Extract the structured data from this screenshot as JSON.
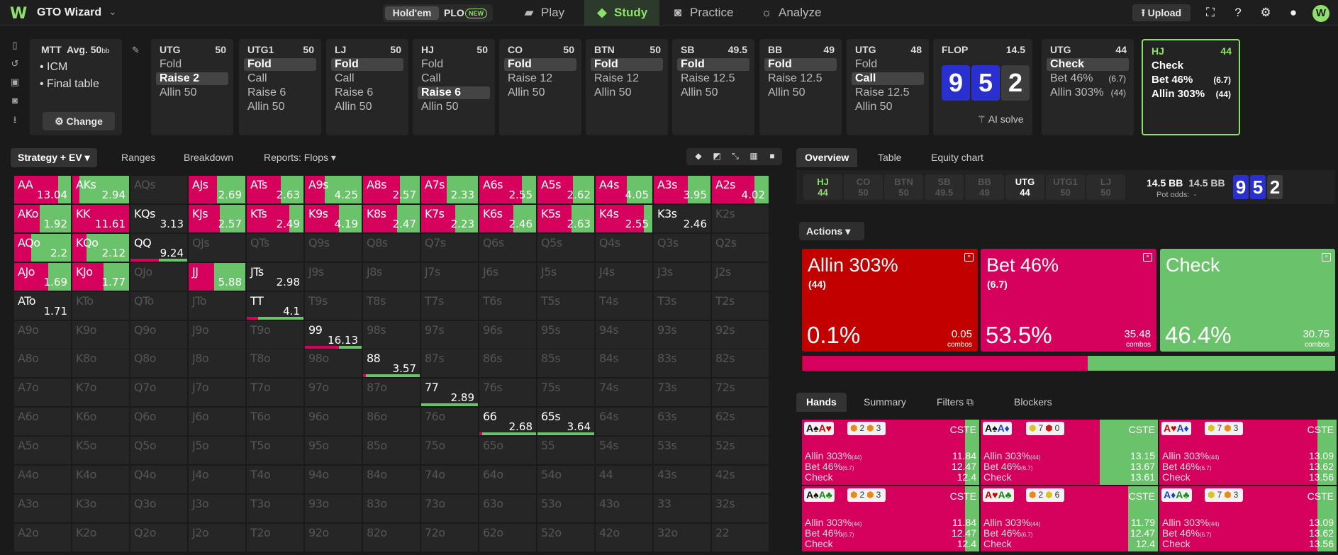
{
  "app": {
    "logo": "W",
    "title": "GTO Wizard"
  },
  "game_toggle": {
    "holdem": "Hold'em",
    "plo": "PLO",
    "new_badge": "NEW"
  },
  "nav": [
    {
      "label": "Play",
      "icon": "play-icon"
    },
    {
      "label": "Study",
      "icon": "study-icon"
    },
    {
      "label": "Practice",
      "icon": "controller-icon"
    },
    {
      "label": "Analyze",
      "icon": "bulb-icon"
    }
  ],
  "upload_label": "Upload",
  "mtt": {
    "title": "MTT",
    "avg": "Avg. 50",
    "bb": "bb",
    "bullets": [
      "ICM",
      "Final table"
    ],
    "change": "Change"
  },
  "positions": [
    {
      "name": "UTG",
      "stack": "50",
      "actions": [
        "Fold",
        "Raise 2",
        "Allin 50"
      ],
      "selected": 1
    },
    {
      "name": "UTG1",
      "stack": "50",
      "actions": [
        "Fold",
        "Call",
        "Raise 6",
        "Allin 50"
      ],
      "selected": 0
    },
    {
      "name": "LJ",
      "stack": "50",
      "actions": [
        "Fold",
        "Call",
        "Raise 6",
        "Allin 50"
      ],
      "selected": 0
    },
    {
      "name": "HJ",
      "stack": "50",
      "actions": [
        "Fold",
        "Call",
        "Raise 6",
        "Allin 50"
      ],
      "selected": 2
    },
    {
      "name": "CO",
      "stack": "50",
      "actions": [
        "Fold",
        "Raise 12",
        "Allin 50"
      ],
      "selected": 0
    },
    {
      "name": "BTN",
      "stack": "50",
      "actions": [
        "Fold",
        "Raise 12",
        "Allin 50"
      ],
      "selected": 0
    },
    {
      "name": "SB",
      "stack": "49.5",
      "actions": [
        "Fold",
        "Raise 12.5",
        "Allin 50"
      ],
      "selected": 0
    },
    {
      "name": "BB",
      "stack": "49",
      "actions": [
        "Fold",
        "Raise 12.5",
        "Allin 50"
      ],
      "selected": 0
    },
    {
      "name": "UTG",
      "stack": "48",
      "actions": [
        "Fold",
        "Call",
        "Raise 12.5",
        "Allin 50"
      ],
      "selected": 1
    }
  ],
  "flop": {
    "name": "FLOP",
    "pot": "14.5",
    "cards": [
      "9",
      "5",
      "2"
    ],
    "ai_solve": "AI solve"
  },
  "utg_flop": {
    "name": "UTG",
    "stack": "44",
    "actions": [
      {
        "label": "Check",
        "r": ""
      },
      {
        "label": "Bet 46%",
        "r": "(6.7)"
      },
      {
        "label": "Allin 303%",
        "r": "(44)"
      }
    ]
  },
  "hj_flop": {
    "name": "HJ",
    "stack": "44",
    "actions": [
      {
        "label": "Check",
        "r": ""
      },
      {
        "label": "Bet 46%",
        "r": "(6.7)"
      },
      {
        "label": "Allin 303%",
        "r": "(44)"
      }
    ]
  },
  "left_tabs": {
    "strategy": "Strategy + EV",
    "ranges": "Ranges",
    "breakdown": "Breakdown",
    "reports": "Reports: Flops"
  },
  "right_tabs": [
    "Overview",
    "Table",
    "Equity chart"
  ],
  "info_chips": [
    {
      "n": "HJ",
      "s": "44"
    },
    {
      "n": "CO",
      "s": "50"
    },
    {
      "n": "BTN",
      "s": "50"
    },
    {
      "n": "SB",
      "s": "49.5"
    },
    {
      "n": "BB",
      "s": "49"
    },
    {
      "n": "UTG",
      "s": "44"
    },
    {
      "n": "UTG1",
      "s": "50"
    },
    {
      "n": "LJ",
      "s": "50"
    }
  ],
  "pot": {
    "a": "14.5 BB",
    "b": "14.5 BB",
    "odds_label": "Pot odds:",
    "odds": "-"
  },
  "actions_label": "Actions",
  "action_boxes": [
    {
      "name": "Allin 303%",
      "size": "(44)",
      "pct": "0.1%",
      "combos": "0.05",
      "combos_label": "combos",
      "color": "#c20000"
    },
    {
      "name": "Bet 46%",
      "size": "(6.7)",
      "pct": "53.5%",
      "combos": "35.48",
      "combos_label": "combos",
      "color": "#d6005d"
    },
    {
      "name": "Check",
      "size": "",
      "pct": "46.4%",
      "combos": "30.75",
      "combos_label": "combos",
      "color": "#6ac36a"
    }
  ],
  "freq": {
    "allin": 0.1,
    "bet": 53.5,
    "check": 46.4
  },
  "hand_tabs": [
    "Hands",
    "Summary",
    "Filters",
    "Blockers"
  ],
  "hand_cards": [
    {
      "c1": "A♠",
      "c1c": "blk",
      "c2": "A♥",
      "c2c": "red",
      "b": [
        [
          "2",
          "o"
        ],
        [
          "3",
          "o"
        ]
      ],
      "check": 0.08,
      "vals": [
        "11.84",
        "12.47",
        "12.4"
      ]
    },
    {
      "c1": "A♠",
      "c1c": "blk",
      "c2": "A♦",
      "c2c": "bl",
      "b": [
        [
          "7",
          "y"
        ],
        [
          "0",
          "r"
        ]
      ],
      "check": 0.33,
      "vals": [
        "13.15",
        "13.67",
        "13.61"
      ]
    },
    {
      "c1": "A♥",
      "c1c": "red",
      "c2": "A♦",
      "c2c": "bl",
      "b": [
        [
          "7",
          "y"
        ],
        [
          "3",
          "o"
        ]
      ],
      "check": 0.11,
      "vals": [
        "13.09",
        "13.62",
        "13.56"
      ]
    },
    {
      "c1": "A♠",
      "c1c": "blk",
      "c2": "A♣",
      "c2c": "gn",
      "b": [
        [
          "2",
          "o"
        ],
        [
          "3",
          "o"
        ]
      ],
      "check": 0.08,
      "vals": [
        "11.84",
        "12.47",
        "12.4"
      ]
    },
    {
      "c1": "A♥",
      "c1c": "red",
      "c2": "A♣",
      "c2c": "gn",
      "b": [
        [
          "2",
          "o"
        ],
        [
          "6",
          "y"
        ]
      ],
      "check": 0.17,
      "vals": [
        "11.79",
        "12.47",
        "12.4"
      ]
    },
    {
      "c1": "A♦",
      "c1c": "bl",
      "c2": "A♣",
      "c2c": "gn",
      "b": [
        [
          "7",
          "y"
        ],
        [
          "3",
          "o"
        ]
      ],
      "check": 0.11,
      "vals": [
        "13.09",
        "13.62",
        "13.56"
      ]
    }
  ],
  "hand_labels": [
    "Allin 303%",
    "Bet 46%",
    "Check"
  ],
  "hand_label_sub": [
    "(44)",
    "(6.7)",
    ""
  ],
  "cste": "CSTE",
  "grid": {
    "ranks": [
      "A",
      "K",
      "Q",
      "J",
      "T",
      "9",
      "8",
      "7",
      "6",
      "5",
      "4",
      "3",
      "2"
    ],
    "cells": {
      "AA": [
        0.78,
        0.22,
        "13.04"
      ],
      "AKs": [
        0.13,
        0.87,
        "2.94"
      ],
      "AJs": [
        0.5,
        0.5,
        "2.69"
      ],
      "ATs": [
        0.6,
        0.4,
        "2.63"
      ],
      "A9s": [
        0.35,
        0.65,
        "4.25"
      ],
      "A8s": [
        0.65,
        0.35,
        "2.57"
      ],
      "A7s": [
        0.45,
        0.55,
        "2.33"
      ],
      "A6s": [
        0.75,
        0.25,
        "2.55"
      ],
      "A5s": [
        0.62,
        0.38,
        "2.62"
      ],
      "A4s": [
        0.55,
        0.45,
        "4.05"
      ],
      "A3s": [
        0.6,
        0.4,
        "3.95"
      ],
      "A2s": [
        0.75,
        0.25,
        "4.02"
      ],
      "AKo": [
        0.45,
        0.55,
        "1.92"
      ],
      "KK": [
        1,
        0,
        "11.61"
      ],
      "KQs": [
        0,
        0,
        "3.13"
      ],
      "KJs": [
        0.55,
        0.45,
        "2.57"
      ],
      "KTs": [
        0.75,
        0.25,
        "2.49"
      ],
      "K9s": [
        0.6,
        0.4,
        "4.19"
      ],
      "K8s": [
        0.6,
        0.4,
        "2.47"
      ],
      "K7s": [
        0.6,
        0.4,
        "2.23"
      ],
      "K6s": [
        0.6,
        0.4,
        "2.46"
      ],
      "K5s": [
        0.6,
        0.4,
        "2.63"
      ],
      "K4s": [
        0.85,
        0.15,
        "2.55"
      ],
      "K3s": [
        0,
        0,
        "2.46"
      ],
      "AQo": [
        0.3,
        0.7,
        "2.2"
      ],
      "KQo": [
        0.25,
        0.75,
        "2.12"
      ],
      "QQ": [
        0.5,
        0.5,
        "9.24"
      ],
      "AJo": [
        0.6,
        0.4,
        "1.69"
      ],
      "KJo": [
        0.55,
        0.45,
        "1.77"
      ],
      "JJ": [
        0.45,
        0.55,
        "5.88"
      ],
      "JTs": [
        0,
        0,
        "2.98"
      ],
      "ATo": [
        0,
        0,
        "1.71"
      ],
      "TT": [
        0.2,
        0.8,
        "4.1"
      ],
      "99": [
        0.6,
        0.4,
        "16.13"
      ],
      "88": [
        0.05,
        0.95,
        "3.57"
      ],
      "77": [
        0,
        1,
        "2.89"
      ],
      "66": [
        0.05,
        0.95,
        "2.68"
      ],
      "65s": [
        0,
        1,
        "3.64"
      ]
    }
  }
}
